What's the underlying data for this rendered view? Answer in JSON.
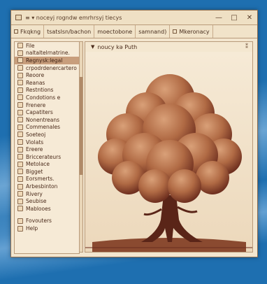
{
  "window": {
    "title": "≡ ▾ noceyj rogndw emrhrsyj tiecys",
    "minimize": "—",
    "maximize": "□",
    "close": "✕"
  },
  "toolbar": {
    "items": [
      {
        "label": "Fkqkng",
        "icon": "folder-icon"
      },
      {
        "label": "tsatslsn/bachon",
        "icon": "none"
      },
      {
        "label": "moectobone",
        "icon": "none"
      },
      {
        "label": "samnand)",
        "icon": "none"
      },
      {
        "label": "Mkeronacy",
        "icon": "document-icon"
      }
    ]
  },
  "sidebar": {
    "items": [
      {
        "label": "File"
      },
      {
        "label": "naltaltelrnatrine."
      },
      {
        "label": "Regnysk:legal",
        "selected": true
      },
      {
        "label": "crpodrdenercartero"
      },
      {
        "label": "Reoore"
      },
      {
        "label": "Reanas"
      },
      {
        "label": "Restntions"
      },
      {
        "label": "Condotions e"
      },
      {
        "label": "Frenere"
      },
      {
        "label": "Capatiters"
      },
      {
        "label": "Nonentreans"
      },
      {
        "label": "Commenales"
      },
      {
        "label": "Soeteoj"
      },
      {
        "label": "Violats"
      },
      {
        "label": "Ereere"
      },
      {
        "label": "Briccerateurs"
      },
      {
        "label": "Metolace"
      },
      {
        "label": "Bigget"
      },
      {
        "label": "Eorsmerts."
      },
      {
        "label": "Arbesbinton"
      },
      {
        "label": "Rivery"
      },
      {
        "label": "Seubise"
      },
      {
        "label": "Mablooes"
      },
      {
        "label": "Fovouters",
        "gap": true
      },
      {
        "label": "Help"
      }
    ]
  },
  "content": {
    "header": "noucy kə Puth",
    "header_close": "⁑"
  },
  "colors": {
    "canopy_light": "#c9865a",
    "canopy_mid": "#a65a38",
    "canopy_dark": "#6b2d1e",
    "trunk": "#5a2518",
    "ground": "#7a3a26"
  }
}
